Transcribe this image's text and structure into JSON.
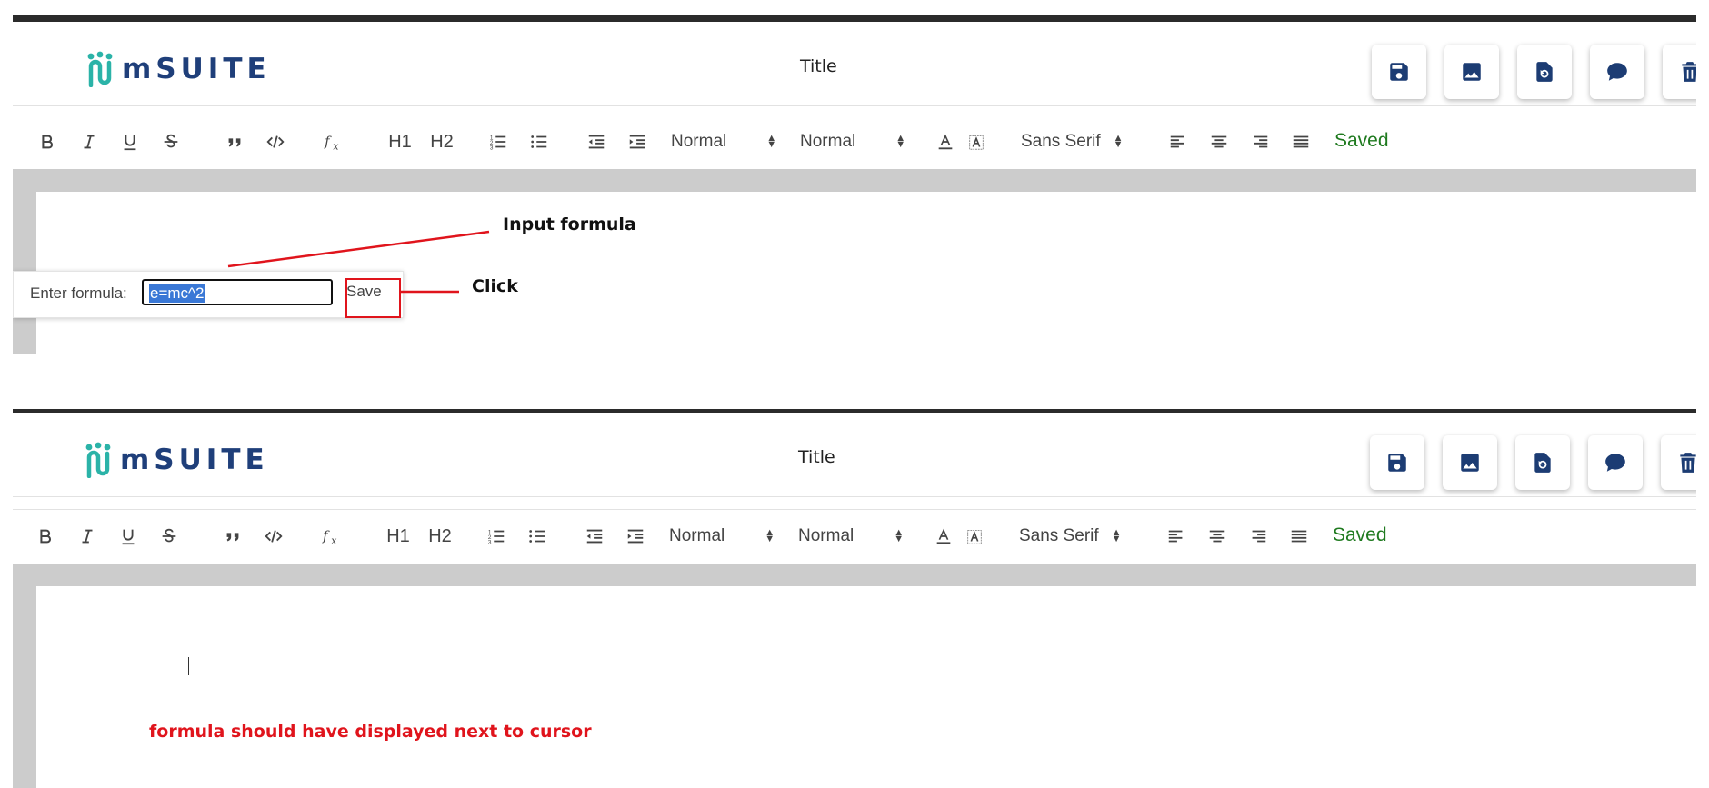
{
  "app": {
    "logo_text": "mSUITE",
    "title": "Title"
  },
  "header_buttons": [
    {
      "icon": "save-icon"
    },
    {
      "icon": "image-icon"
    },
    {
      "icon": "file-restore-icon"
    },
    {
      "icon": "comment-icon"
    },
    {
      "icon": "trash-icon"
    }
  ],
  "toolbar": {
    "h1": "H1",
    "h2": "H2",
    "header_select": "Normal",
    "size_select": "Normal",
    "font_select": "Sans Serif",
    "status": "Saved"
  },
  "formula_popup": {
    "label": "Enter formula:",
    "value": "e=mc^2",
    "save_label": "Save"
  },
  "annotations": {
    "input_formula": "Input formula",
    "click": "Click",
    "formula_missing": "formula should have displayed next to cursor"
  },
  "colors": {
    "accent_teal": "#2bb3a8",
    "brand_navy": "#1f3f7a",
    "saved_green": "#1f7a1f",
    "annotation_red": "#e0141c"
  }
}
